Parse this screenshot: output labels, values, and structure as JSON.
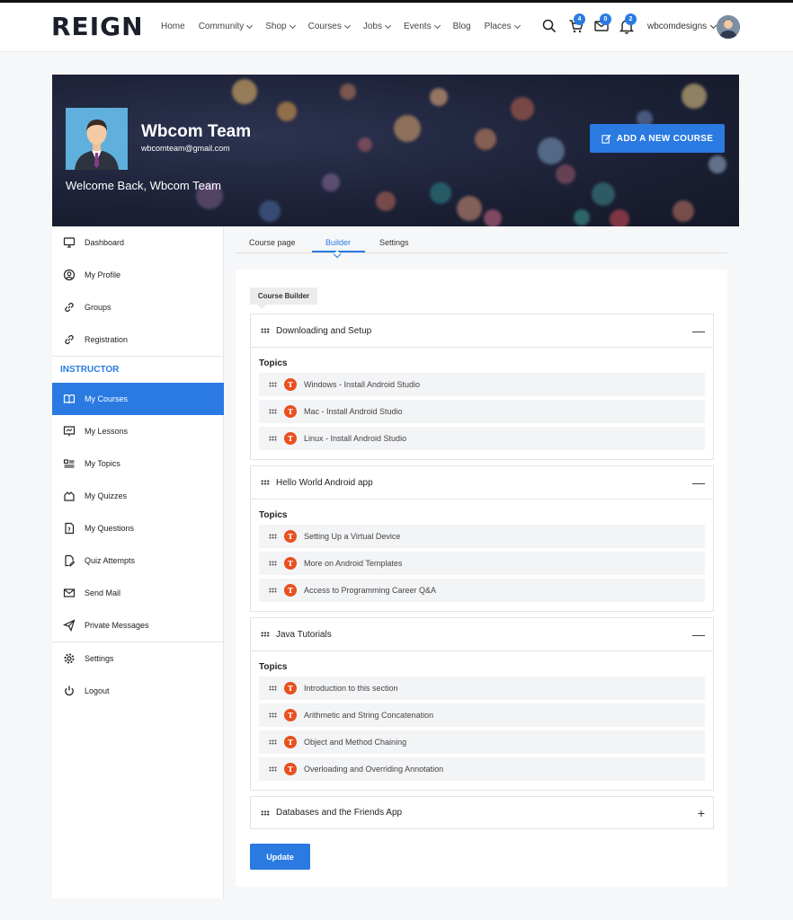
{
  "header": {
    "logo": "REIGN",
    "nav": [
      {
        "label": "Home",
        "dropdown": false
      },
      {
        "label": "Community",
        "dropdown": true
      },
      {
        "label": "Shop",
        "dropdown": true
      },
      {
        "label": "Courses",
        "dropdown": true
      },
      {
        "label": "Jobs",
        "dropdown": true
      },
      {
        "label": "Events",
        "dropdown": true
      },
      {
        "label": "Blog",
        "dropdown": false
      },
      {
        "label": "Places",
        "dropdown": true
      }
    ],
    "cart_count": "4",
    "messages_count": "0",
    "notifications_count": "2",
    "username": "wbcomdesigns"
  },
  "cover": {
    "name": "Wbcom Team",
    "email": "wbcomteam@gmail.com",
    "welcome": "Welcome Back, Wbcom Team",
    "add_course_label": "ADD A NEW COURSE"
  },
  "sidebar": {
    "items_top": [
      {
        "label": "Dashboard",
        "icon": "monitor-icon"
      },
      {
        "label": "My Profile",
        "icon": "user-circle-icon"
      },
      {
        "label": "Groups",
        "icon": "link-icon"
      },
      {
        "label": "Registration",
        "icon": "link-icon"
      }
    ],
    "instructor_heading": "INSTRUCTOR",
    "items_instructor": [
      {
        "label": "My Courses",
        "icon": "book-icon",
        "active": true
      },
      {
        "label": "My Lessons",
        "icon": "presentation-icon"
      },
      {
        "label": "My Topics",
        "icon": "list-icon"
      },
      {
        "label": "My Quizzes",
        "icon": "puzzle-icon"
      },
      {
        "label": "My Questions",
        "icon": "question-file-icon"
      },
      {
        "label": "Quiz Attempts",
        "icon": "file-edit-icon"
      },
      {
        "label": "Send Mail",
        "icon": "mail-icon"
      },
      {
        "label": "Private Messages",
        "icon": "send-icon"
      }
    ],
    "items_bottom": [
      {
        "label": "Settings",
        "icon": "gear-icon"
      },
      {
        "label": "Logout",
        "icon": "power-icon"
      }
    ]
  },
  "tabs": [
    {
      "label": "Course page"
    },
    {
      "label": "Builder",
      "active": true
    },
    {
      "label": "Settings"
    }
  ],
  "builder": {
    "label": "Course Builder",
    "topics_label": "Topics",
    "sections": [
      {
        "title": "Downloading and Setup",
        "expanded": true,
        "toggle": "—",
        "topics": [
          "Windows - Install Android Studio",
          "Mac - Install Android Studio",
          "Linux - Install Android Studio"
        ]
      },
      {
        "title": "Hello World Android app",
        "expanded": true,
        "toggle": "—",
        "topics": [
          "Setting Up a Virtual Device",
          "More on Android Templates",
          "Access to Programming Career Q&A"
        ]
      },
      {
        "title": "Java Tutorials",
        "expanded": true,
        "toggle": "—",
        "topics": [
          "Introduction to this section",
          "Arithmetic and String Concatenation",
          "Object and Method Chaining",
          "Overloading and Overriding Annotation"
        ]
      },
      {
        "title": "Databases and the Friends App",
        "expanded": false,
        "toggle": "+",
        "topics": []
      }
    ],
    "topic_badge": "T",
    "update_label": "Update"
  },
  "colors": {
    "accent": "#2a7ae2",
    "topic_badge": "#e8501e",
    "cover_bg": "#1b2035"
  }
}
